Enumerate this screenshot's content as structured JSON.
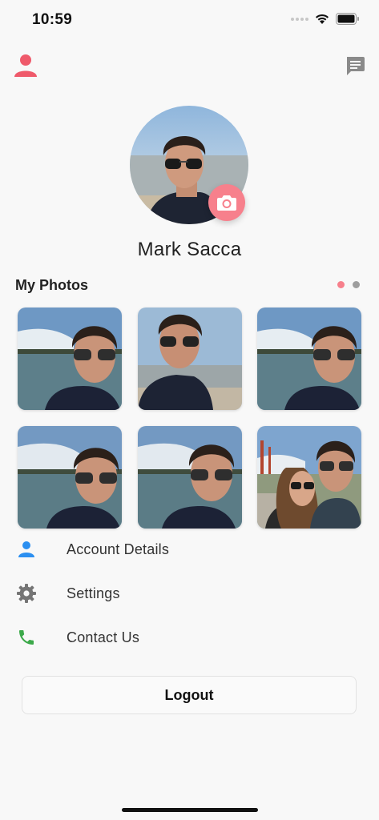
{
  "status_bar": {
    "time": "10:59"
  },
  "header": {
    "left_icon": "person-icon",
    "right_icon": "chat-icon",
    "accent": "#ef5a6b"
  },
  "profile": {
    "name": "Mark Sacca",
    "camera_icon": "camera-icon",
    "camera_color": "#f7808c"
  },
  "photos": {
    "title": "My Photos",
    "page_dots": [
      {
        "color": "#f7808c",
        "active": true
      },
      {
        "color": "#9e9e9e",
        "active": false
      }
    ],
    "items": [
      "photo-1",
      "photo-2",
      "photo-3",
      "photo-4",
      "photo-5",
      "photo-6"
    ]
  },
  "menu": [
    {
      "label": "Account Details",
      "icon": "person-icon",
      "color": "#2b8ff0"
    },
    {
      "label": "Settings",
      "icon": "gear-icon",
      "color": "#757575"
    },
    {
      "label": "Contact Us",
      "icon": "phone-icon",
      "color": "#3ca94a"
    }
  ],
  "logout": {
    "label": "Logout"
  }
}
